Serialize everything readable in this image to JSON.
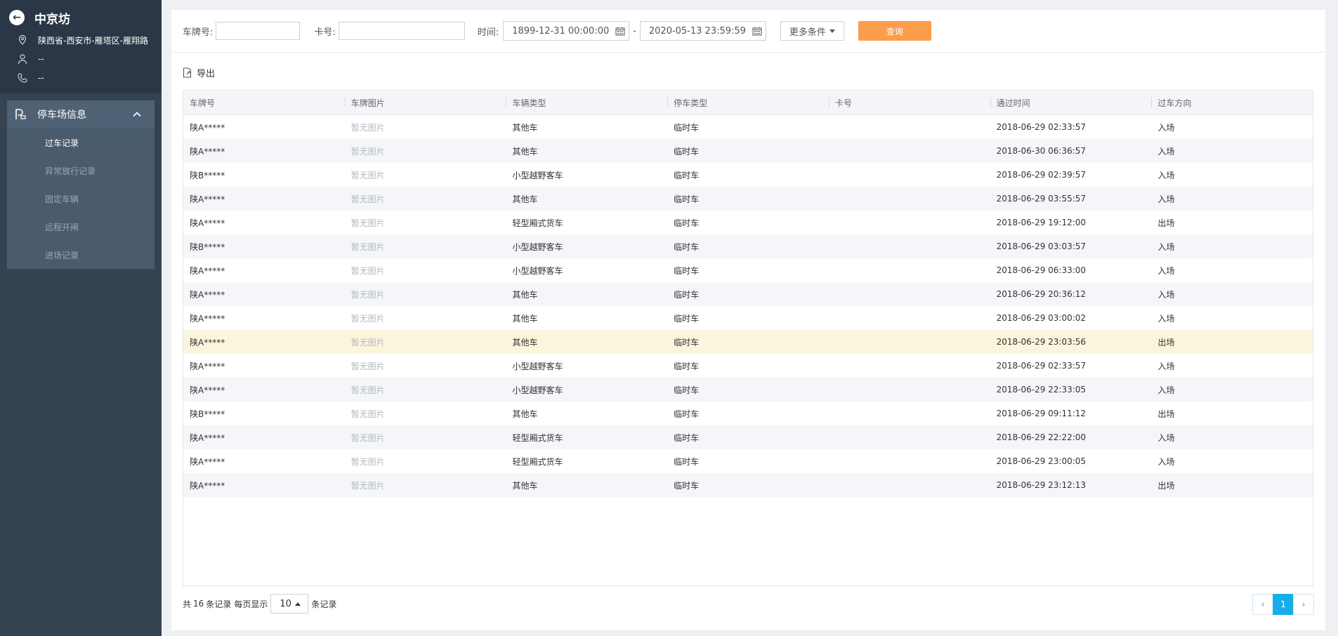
{
  "sidebar": {
    "title": "中京坊",
    "address": "陕西省-西安市-雁塔区-雁翔路",
    "contact_name": "--",
    "contact_phone": "--",
    "menu_group": "停车场信息",
    "items": [
      "过车记录",
      "异常放行记录",
      "固定车辆",
      "远程开闸",
      "进场记录"
    ],
    "active_item": "过车记录"
  },
  "filters": {
    "plate_label": "车牌号:",
    "plate_value": "",
    "card_label": "卡号:",
    "card_value": "",
    "time_label": "时间:",
    "start_time": "1899-12-31 00:00:00",
    "separator": "-",
    "end_time": "2020-05-13 23:59:59",
    "more_label": "更多条件",
    "query_label": "查询"
  },
  "toolbar": {
    "export_label": "导出"
  },
  "table": {
    "columns": [
      "车牌号",
      "车牌图片",
      "车辆类型",
      "停车类型",
      "卡号",
      "通过时间",
      "过车方向"
    ],
    "rows": [
      [
        "陕A*****",
        "暂无图片",
        "其他车",
        "临时车",
        "",
        "2018-06-29 02:33:57",
        "入场"
      ],
      [
        "陕A*****",
        "暂无图片",
        "其他车",
        "临时车",
        "",
        "2018-06-30 06:36:57",
        "入场"
      ],
      [
        "陕B*****",
        "暂无图片",
        "小型越野客车",
        "临时车",
        "",
        "2018-06-29 02:39:57",
        "入场"
      ],
      [
        "陕A*****",
        "暂无图片",
        "其他车",
        "临时车",
        "",
        "2018-06-29 03:55:57",
        "入场"
      ],
      [
        "陕A*****",
        "暂无图片",
        "轻型厢式货车",
        "临时车",
        "",
        "2018-06-29 19:12:00",
        "出场"
      ],
      [
        "陕B*****",
        "暂无图片",
        "小型越野客车",
        "临时车",
        "",
        "2018-06-29 03:03:57",
        "入场"
      ],
      [
        "陕A*****",
        "暂无图片",
        "小型越野客车",
        "临时车",
        "",
        "2018-06-29 06:33:00",
        "入场"
      ],
      [
        "陕A*****",
        "暂无图片",
        "其他车",
        "临时车",
        "",
        "2018-06-29 20:36:12",
        "入场"
      ],
      [
        "陕A*****",
        "暂无图片",
        "其他车",
        "临时车",
        "",
        "2018-06-29 03:00:02",
        "入场"
      ],
      [
        "陕A*****",
        "暂无图片",
        "其他车",
        "临时车",
        "",
        "2018-06-29 23:03:56",
        "出场"
      ],
      [
        "陕A*****",
        "暂无图片",
        "小型越野客车",
        "临时车",
        "",
        "2018-06-29 02:33:57",
        "入场"
      ],
      [
        "陕A*****",
        "暂无图片",
        "小型越野客车",
        "临时车",
        "",
        "2018-06-29 22:33:05",
        "入场"
      ],
      [
        "陕B*****",
        "暂无图片",
        "其他车",
        "临时车",
        "",
        "2018-06-29 09:11:12",
        "出场"
      ],
      [
        "陕A*****",
        "暂无图片",
        "轻型厢式货车",
        "临时车",
        "",
        "2018-06-29 22:22:00",
        "入场"
      ],
      [
        "陕A*****",
        "暂无图片",
        "轻型厢式货车",
        "临时车",
        "",
        "2018-06-29 23:00:05",
        "入场"
      ],
      [
        "陕A*****",
        "暂无图片",
        "其他车",
        "临时车",
        "",
        "2018-06-29 23:12:13",
        "出场"
      ]
    ],
    "highlighted_row": 9
  },
  "pagination": {
    "total_prefix": "共",
    "total": "16",
    "total_suffix": "条记录",
    "per_page_label": "每页显示",
    "page_size": "10",
    "per_page_suffix": "条记录",
    "prev": "‹",
    "current_page": "1",
    "next": "›"
  },
  "colors": {
    "sidebar_bg": "#354252",
    "sidebar_head_bg": "#2b3746",
    "menu_bg": "#4a5b6d",
    "query_button": "#fb9d4b",
    "pager_active": "#16aeea",
    "highlight_row": "#fbf5dc"
  }
}
